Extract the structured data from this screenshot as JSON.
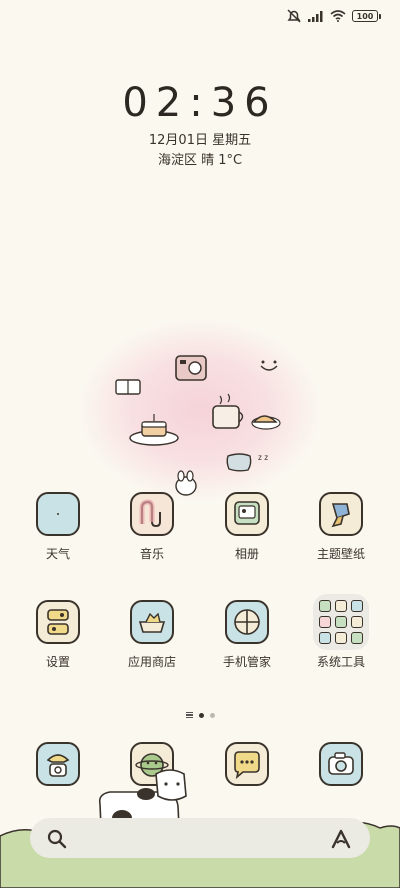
{
  "status": {
    "battery": "100"
  },
  "lockscreen": {
    "time": "02:36",
    "date": "12月01日 星期五",
    "weather": "海淀区 晴 1°C"
  },
  "apps_row1": [
    {
      "label": "天气",
      "icon": "weather-icon",
      "color": "#c9e2e5"
    },
    {
      "label": "音乐",
      "icon": "music-icon",
      "color": "#f6e6d8"
    },
    {
      "label": "相册",
      "icon": "gallery-icon",
      "color": "#f4ecd7"
    },
    {
      "label": "主题壁纸",
      "icon": "theme-icon",
      "color": "#f4ecd7"
    }
  ],
  "apps_row2": [
    {
      "label": "设置",
      "icon": "settings-icon",
      "color": "#f4ecd7"
    },
    {
      "label": "应用商店",
      "icon": "app-store-icon",
      "color": "#c9e2e5"
    },
    {
      "label": "手机管家",
      "icon": "phone-manager-icon",
      "color": "#c9e2e5"
    },
    {
      "label": "系统工具",
      "icon": "folder-icon",
      "color": "#eceae4"
    }
  ],
  "dock": [
    {
      "icon": "phone-icon",
      "color": "#c9e2e5"
    },
    {
      "icon": "browser-icon",
      "color": "#f4ecd7"
    },
    {
      "icon": "messages-icon",
      "color": "#f4ecd7"
    },
    {
      "icon": "camera-icon",
      "color": "#c9e2e5"
    }
  ],
  "page_indicator": {
    "pages": 2,
    "active": 1
  },
  "colors": {
    "background": "#fbf8f0",
    "outline": "#3a332c",
    "grass": "#c9dba8",
    "pink_glow": "#f5d3d8"
  }
}
